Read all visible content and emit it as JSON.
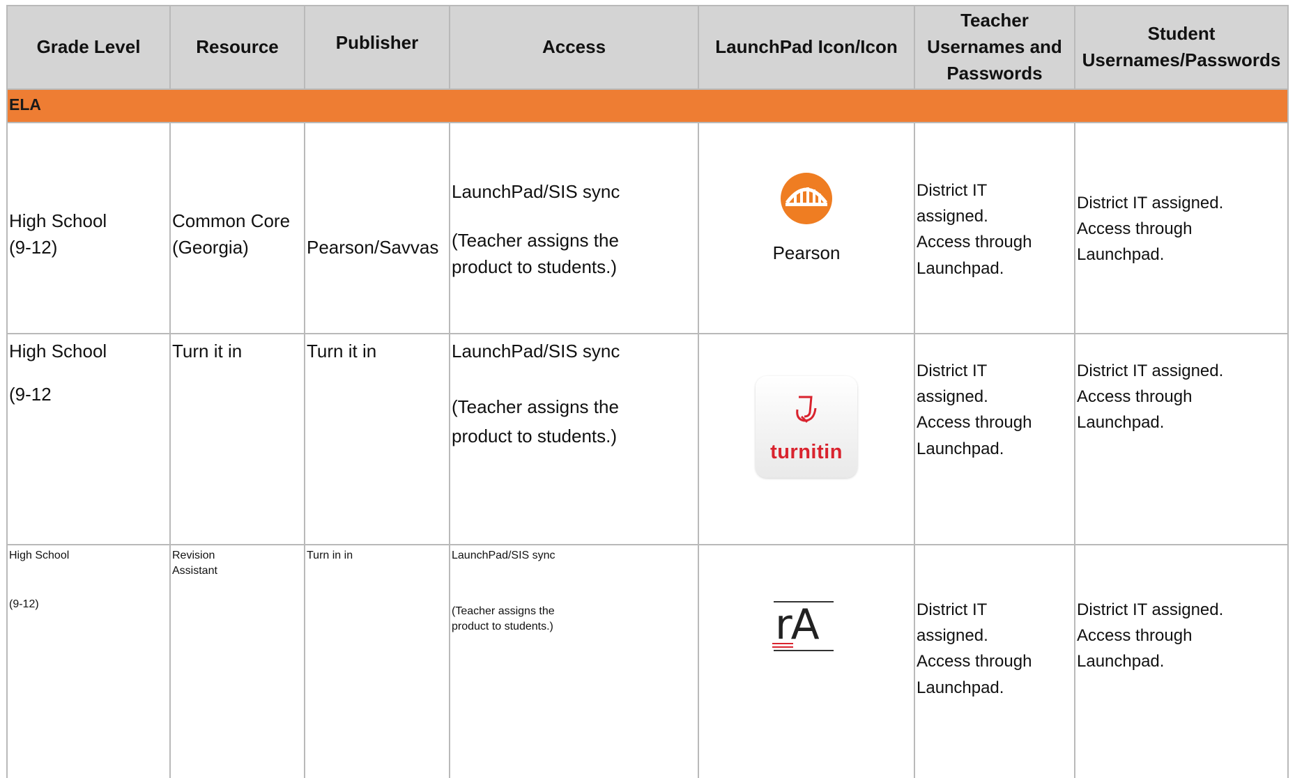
{
  "table": {
    "headers": {
      "grade_level": "Grade Level",
      "resource": "Resource",
      "publisher": "Publisher",
      "access": "Access",
      "launchpad_icon": "LaunchPad Icon/Icon",
      "teacher_line1": "Teacher",
      "teacher_line2": "Usernames and",
      "teacher_line3": "Passwords",
      "student_line1": "Student",
      "student_line2": "Usernames/Passwords"
    },
    "section_label": "ELA",
    "rows": [
      {
        "grade_line1": "High School",
        "grade_line2": "(9-12)",
        "resource_line1": "Common Core",
        "resource_line2": "(Georgia)",
        "publisher": "Pearson/Savvas",
        "access_line1": "LaunchPad/SIS sync",
        "access_line2": "(Teacher assigns the",
        "access_line3": "product to students.)",
        "icon_name": "pearson-icon",
        "icon_caption": "Pearson",
        "teacher_line1": "District IT",
        "teacher_line2": "assigned.",
        "teacher_line3": "Access through",
        "teacher_line4": "Launchpad.",
        "student_line1": "District IT assigned.",
        "student_line2": "Access through",
        "student_line3": "Launchpad."
      },
      {
        "grade_line1": "High School",
        "grade_line2": "(9-12",
        "resource_line1": "Turn it in",
        "publisher": "Turn it in",
        "access_line1": "LaunchPad/SIS sync",
        "access_line2": "(Teacher assigns the",
        "access_line3": "product to students.)",
        "icon_name": "turnitin-icon",
        "icon_text": "turnitin",
        "teacher_line1": "District IT",
        "teacher_line2": "assigned.",
        "teacher_line3": "Access through",
        "teacher_line4": "Launchpad.",
        "student_line1": "District IT assigned.",
        "student_line2": "Access through",
        "student_line3": "Launchpad."
      },
      {
        "grade_line1": "High School",
        "grade_line2": "(9-12)",
        "resource_line1": "Revision",
        "resource_line2": "Assistant",
        "publisher": "Turn in in",
        "access_line1": "LaunchPad/SIS sync",
        "access_line2": "(Teacher assigns the",
        "access_line3": "product to students.)",
        "icon_name": "revision-assistant-icon",
        "icon_text": "rA",
        "teacher_line1": "District IT",
        "teacher_line2": "assigned.",
        "teacher_line3": "Access through",
        "teacher_line4": "Launchpad.",
        "student_line1": "District IT assigned.",
        "student_line2": "Access through",
        "student_line3": "Launchpad."
      }
    ]
  },
  "colors": {
    "header_bg": "#d4d4d4",
    "section_bg": "#ee7d33",
    "pearson_orange": "#ef7d22",
    "turnitin_red": "#d9232e",
    "grid": "#b9b9b9"
  }
}
